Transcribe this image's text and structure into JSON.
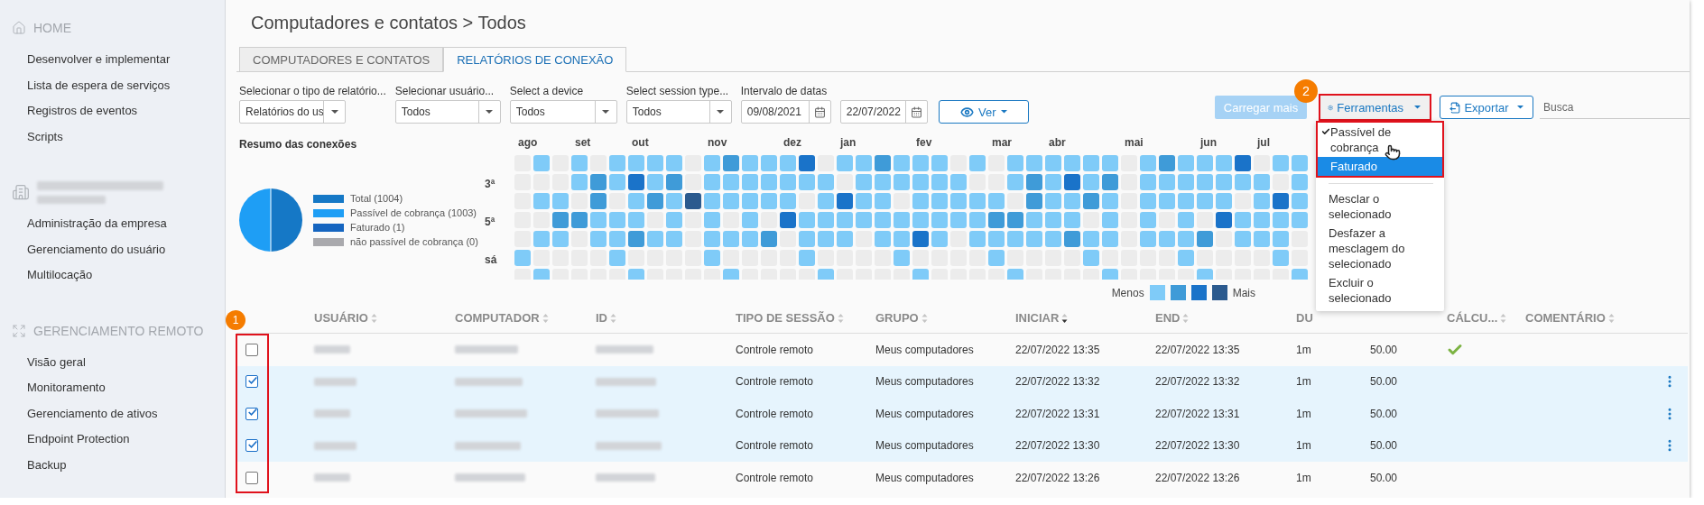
{
  "sidebar": {
    "sections": [
      {
        "kind": "heading",
        "title": "HOME",
        "items": [
          "Desenvolver e implementar",
          "Lista de espera de serviços",
          "Registros de eventos",
          "Scripts"
        ]
      },
      {
        "kind": "redacted",
        "items": [
          "Administração da empresa",
          "Gerenciamento do usuário",
          "Multilocação"
        ]
      },
      {
        "kind": "heading",
        "title": "GERENCIAMENTO REMOTO",
        "items": [
          "Visão geral",
          "Monitoramento",
          "Gerenciamento de ativos",
          "Endpoint Protection",
          "Backup"
        ]
      }
    ]
  },
  "page_title": "Computadores e contatos > Todos",
  "tabs": [
    {
      "label": "COMPUTADORES E CONTATOS",
      "selected": false
    },
    {
      "label": "RELATÓRIOS DE CONEXÃO",
      "selected": true
    }
  ],
  "filters": [
    {
      "kind": "select",
      "label": "Selecionar o tipo de relatório...",
      "value": "Relatórios do us"
    },
    {
      "kind": "select",
      "label": "Selecionar usuário...",
      "value": "Todos"
    },
    {
      "kind": "select",
      "label": "Select a device",
      "value": "Todos"
    },
    {
      "kind": "select",
      "label": "Select session type...",
      "value": "Todos"
    },
    {
      "kind": "daterange",
      "label": "Intervalo de datas",
      "from": "09/08/2021",
      "to": "22/07/2022"
    }
  ],
  "view_button": "Ver",
  "actions": {
    "load_more": {
      "label": "Carregar mais",
      "disabled": true
    },
    "tools": {
      "label": "Ferramentas",
      "expanded": true
    },
    "export": "Exportar",
    "search": {
      "placeholder": "Busca"
    }
  },
  "tools_menu": [
    {
      "kind": "option",
      "label": "Passível de cobrança",
      "checked": true,
      "highlighted": false
    },
    {
      "kind": "option",
      "label": "Faturado",
      "checked": false,
      "highlighted": true
    },
    {
      "kind": "divider"
    },
    {
      "kind": "action",
      "label": "Mesclar o selecionado"
    },
    {
      "kind": "action",
      "label": "Desfazer a mesclagem do selecionado"
    },
    {
      "kind": "action",
      "label": "Excluir o selecionado"
    }
  ],
  "summary": {
    "title": "Resumo das conexões",
    "legend": [
      {
        "label": "Total (1004)",
        "color": "#1578c6"
      },
      {
        "label": "Passível de cobrança (1003)",
        "color": "#1e9ef5"
      },
      {
        "label": "Faturado (1)",
        "color": "#1565c0"
      },
      {
        "label": "não passível de cobrança (0)",
        "color": "#a9a9ad"
      }
    ],
    "months": [
      "ago",
      "set",
      "out",
      "nov",
      "dez",
      "jan",
      "fev",
      "mar",
      "abr",
      "mai",
      "jun",
      "jul"
    ],
    "days": [
      "3ª",
      "5ª",
      "sá"
    ],
    "scale": {
      "less": "Menos",
      "more": "Mais"
    }
  },
  "table": {
    "columns": [
      {
        "label": "USUÁRIO",
        "sorted": false
      },
      {
        "label": "COMPUTADOR",
        "sorted": false
      },
      {
        "label": "ID",
        "sorted": false
      },
      {
        "label": "TIPO DE SESSÃO",
        "sorted": false
      },
      {
        "label": "GRUPO",
        "sorted": false
      },
      {
        "label": "INICIAR",
        "sorted": true
      },
      {
        "label": "END",
        "sorted": false
      },
      {
        "label": "DU"
      },
      {
        "label": "CÁLCU...",
        "sorted": false
      },
      {
        "label": "COMENTÁRIO",
        "sorted": false
      }
    ],
    "rows": [
      {
        "checked": false,
        "session_type": "Controle remoto",
        "group": "Meus computadores",
        "start": "22/07/2022 13:35",
        "end": "22/07/2022 13:35",
        "duration": "1m",
        "value": "50.00",
        "calculated": true
      },
      {
        "checked": true,
        "session_type": "Controle remoto",
        "group": "Meus computadores",
        "start": "22/07/2022 13:32",
        "end": "22/07/2022 13:32",
        "duration": "1m",
        "value": "50.00",
        "calculated": false
      },
      {
        "checked": true,
        "session_type": "Controle remoto",
        "group": "Meus computadores",
        "start": "22/07/2022 13:31",
        "end": "22/07/2022 13:31",
        "duration": "1m",
        "value": "50.00",
        "calculated": false
      },
      {
        "checked": true,
        "session_type": "Controle remoto",
        "group": "Meus computadores",
        "start": "22/07/2022 13:30",
        "end": "22/07/2022 13:30",
        "duration": "1m",
        "value": "50.00",
        "calculated": false
      },
      {
        "checked": false,
        "session_type": "Controle remoto",
        "group": "Meus computadores",
        "start": "22/07/2022 13:26",
        "end": "22/07/2022 13:26",
        "duration": "1m",
        "value": "50.00",
        "calculated": false
      }
    ]
  },
  "annotations": [
    {
      "label": "1"
    },
    {
      "label": "2"
    }
  ]
}
